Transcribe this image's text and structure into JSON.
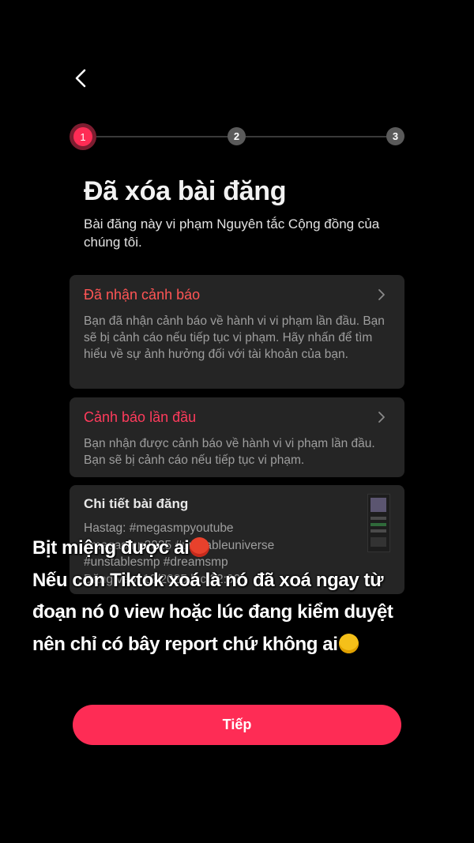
{
  "stepper": {
    "steps": [
      "1",
      "2",
      "3"
    ],
    "active_step": 1
  },
  "header": {
    "title": "Đã xóa bài đăng",
    "subtitle": "Bài đăng này vi phạm Nguyên tắc Cộng đồng của chúng tôi."
  },
  "cards": [
    {
      "title": "Đã nhận cảnh báo",
      "body": "Bạn đã nhận cảnh báo về hành vi vi phạm lần đầu. Bạn sẽ bị cảnh cáo nếu tiếp tục vi phạm. Hãy nhấn để tìm hiểu về sự ảnh hưởng đối với tài khoản của bạn."
    },
    {
      "title": "Cảnh báo lần đầu",
      "body": "Bạn nhận được cảnh báo về hành vi vi phạm lần đầu. Bạn sẽ bị cảnh cáo nếu tiếp tục vi phạm."
    }
  ],
  "post_details": {
    "title": "Chi tiết bài đăng",
    "line1": "Hastag: #megasmpyoutube",
    "line2": "#megasmp2025 #unstableuniverse",
    "line3": "#unstablesmp #dreamsmp",
    "line4": "Đăng vào: 12/2025 lúc 22:00"
  },
  "overlay_caption": {
    "line1": "Bịt miệng được ai",
    "line2": "Nếu con Tiktok xoá là nó đã xoá ngay từ",
    "line3": "đoạn nó 0 view hoặc lúc đang kiểm duyệt",
    "line4": "nên chỉ có bây report chứ không ai"
  },
  "icons": {
    "back": "chevron-left-icon",
    "chevron": "chevron-right-icon",
    "emoji1": "hot-face-emoji",
    "emoji2": "rolling-laughing-emoji"
  },
  "colors": {
    "accent": "#fe2c55",
    "warning_title": "#ff5555",
    "card_bg": "#252525"
  },
  "cta": {
    "label": "Tiếp"
  }
}
